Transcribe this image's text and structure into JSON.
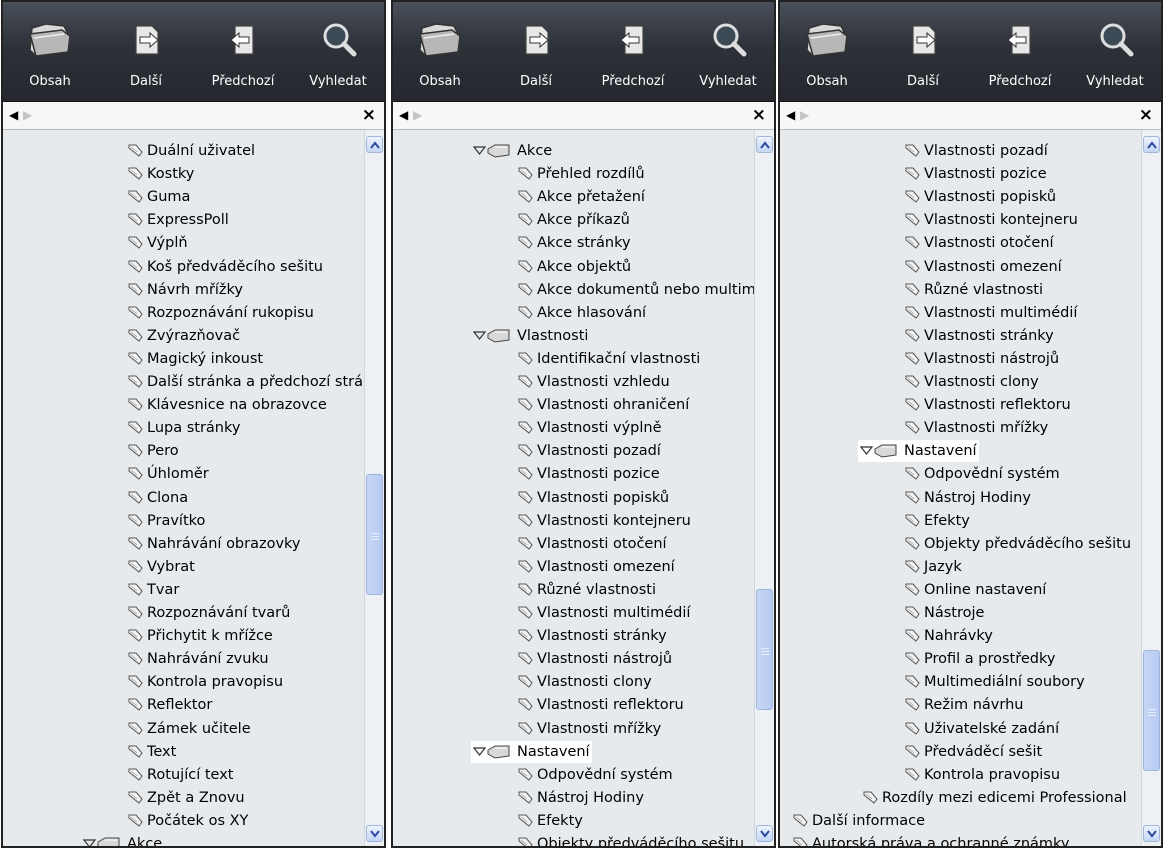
{
  "colors": {
    "toolbar_dark": "#2d3138",
    "tree_bg": "#e7eaed",
    "scroll_thumb": "#c6d6f6",
    "highlight": "#ffffff"
  },
  "icons": {
    "toc": "folder-icon",
    "next": "next-page-icon",
    "prev": "previous-page-icon",
    "search": "magnifier-icon",
    "leaf": "topic-page-icon",
    "group": "book-icon",
    "expanded": "triangle-down-icon",
    "close": "close-icon"
  },
  "panels": [
    {
      "toolbar": {
        "contents": "Obsah",
        "next": "Další",
        "previous": "Předchozí",
        "search": "Vyhledat"
      },
      "tabs": {
        "back": "◀",
        "forward": "▶",
        "close": "×"
      },
      "items": [
        {
          "type": "leaf",
          "indent": 2,
          "label": "Duální uživatel"
        },
        {
          "type": "leaf",
          "indent": 2,
          "label": "Kostky"
        },
        {
          "type": "leaf",
          "indent": 2,
          "label": "Guma"
        },
        {
          "type": "leaf",
          "indent": 2,
          "label": "ExpressPoll"
        },
        {
          "type": "leaf",
          "indent": 2,
          "label": "Výplň"
        },
        {
          "type": "leaf",
          "indent": 2,
          "label": "Koš předváděcího sešitu"
        },
        {
          "type": "leaf",
          "indent": 2,
          "label": "Návrh mřížky"
        },
        {
          "type": "leaf",
          "indent": 2,
          "label": "Rozpoznávání rukopisu"
        },
        {
          "type": "leaf",
          "indent": 2,
          "label": "Zvýrazňovač"
        },
        {
          "type": "leaf",
          "indent": 2,
          "label": "Magický inkoust"
        },
        {
          "type": "leaf",
          "indent": 2,
          "label": "Další stránka a předchozí strá"
        },
        {
          "type": "leaf",
          "indent": 2,
          "label": "Klávesnice na obrazovce"
        },
        {
          "type": "leaf",
          "indent": 2,
          "label": "Lupa stránky"
        },
        {
          "type": "leaf",
          "indent": 2,
          "label": "Pero"
        },
        {
          "type": "leaf",
          "indent": 2,
          "label": "Úhloměr"
        },
        {
          "type": "leaf",
          "indent": 2,
          "label": "Clona"
        },
        {
          "type": "leaf",
          "indent": 2,
          "label": "Pravítko"
        },
        {
          "type": "leaf",
          "indent": 2,
          "label": "Nahrávání obrazovky"
        },
        {
          "type": "leaf",
          "indent": 2,
          "label": "Vybrat"
        },
        {
          "type": "leaf",
          "indent": 2,
          "label": "Tvar"
        },
        {
          "type": "leaf",
          "indent": 2,
          "label": "Rozpoznávání tvarů"
        },
        {
          "type": "leaf",
          "indent": 2,
          "label": "Přichytit k mřížce"
        },
        {
          "type": "leaf",
          "indent": 2,
          "label": "Nahrávání zvuku"
        },
        {
          "type": "leaf",
          "indent": 2,
          "label": "Kontrola pravopisu"
        },
        {
          "type": "leaf",
          "indent": 2,
          "label": "Reflektor"
        },
        {
          "type": "leaf",
          "indent": 2,
          "label": "Zámek učitele"
        },
        {
          "type": "leaf",
          "indent": 2,
          "label": "Text"
        },
        {
          "type": "leaf",
          "indent": 2,
          "label": "Rotující text"
        },
        {
          "type": "leaf",
          "indent": 2,
          "label": "Zpět a Znovu"
        },
        {
          "type": "leaf",
          "indent": 2,
          "label": "Počátek os XY"
        },
        {
          "type": "group",
          "indent": 1,
          "label": "Akce"
        }
      ],
      "scroll": {
        "position": 0.58,
        "visible_fraction": 0.18
      }
    },
    {
      "toolbar": {
        "contents": "Obsah",
        "next": "Další",
        "previous": "Předchozí",
        "search": "Vyhledat"
      },
      "tabs": {
        "back": "◀",
        "forward": "▶",
        "close": "×"
      },
      "items": [
        {
          "type": "group",
          "indent": 1,
          "label": "Akce"
        },
        {
          "type": "leaf",
          "indent": 2,
          "label": "Přehled rozdílů"
        },
        {
          "type": "leaf",
          "indent": 2,
          "label": "Akce přetažení"
        },
        {
          "type": "leaf",
          "indent": 2,
          "label": "Akce příkazů"
        },
        {
          "type": "leaf",
          "indent": 2,
          "label": "Akce stránky"
        },
        {
          "type": "leaf",
          "indent": 2,
          "label": "Akce objektů"
        },
        {
          "type": "leaf",
          "indent": 2,
          "label": "Akce dokumentů nebo multimé"
        },
        {
          "type": "leaf",
          "indent": 2,
          "label": "Akce hlasování"
        },
        {
          "type": "group",
          "indent": 1,
          "label": "Vlastnosti"
        },
        {
          "type": "leaf",
          "indent": 2,
          "label": "Identifikační vlastnosti"
        },
        {
          "type": "leaf",
          "indent": 2,
          "label": "Vlastnosti vzhledu"
        },
        {
          "type": "leaf",
          "indent": 2,
          "label": "Vlastnosti ohraničení"
        },
        {
          "type": "leaf",
          "indent": 2,
          "label": "Vlastnosti výplně"
        },
        {
          "type": "leaf",
          "indent": 2,
          "label": "Vlastnosti pozadí"
        },
        {
          "type": "leaf",
          "indent": 2,
          "label": "Vlastnosti pozice"
        },
        {
          "type": "leaf",
          "indent": 2,
          "label": "Vlastnosti popisků"
        },
        {
          "type": "leaf",
          "indent": 2,
          "label": "Vlastnosti kontejneru"
        },
        {
          "type": "leaf",
          "indent": 2,
          "label": "Vlastnosti otočení"
        },
        {
          "type": "leaf",
          "indent": 2,
          "label": "Vlastnosti omezení"
        },
        {
          "type": "leaf",
          "indent": 2,
          "label": "Různé vlastnosti"
        },
        {
          "type": "leaf",
          "indent": 2,
          "label": "Vlastnosti multimédií"
        },
        {
          "type": "leaf",
          "indent": 2,
          "label": "Vlastnosti stránky"
        },
        {
          "type": "leaf",
          "indent": 2,
          "label": "Vlastnosti nástrojů"
        },
        {
          "type": "leaf",
          "indent": 2,
          "label": "Vlastnosti clony"
        },
        {
          "type": "leaf",
          "indent": 2,
          "label": "Vlastnosti reflektoru"
        },
        {
          "type": "leaf",
          "indent": 2,
          "label": "Vlastnosti mřížky"
        },
        {
          "type": "group",
          "indent": 1,
          "label": "Nastavení",
          "highlighted": true
        },
        {
          "type": "leaf",
          "indent": 2,
          "label": "Odpovědní systém"
        },
        {
          "type": "leaf",
          "indent": 2,
          "label": "Nástroj Hodiny"
        },
        {
          "type": "leaf",
          "indent": 2,
          "label": "Efekty"
        },
        {
          "type": "leaf",
          "indent": 2,
          "label": "Objekty předváděcího sešitu"
        }
      ],
      "scroll": {
        "position": 0.79,
        "visible_fraction": 0.18
      }
    },
    {
      "toolbar": {
        "contents": "Obsah",
        "next": "Další",
        "previous": "Předchozí",
        "search": "Vyhledat"
      },
      "tabs": {
        "back": "◀",
        "forward": "▶",
        "close": "×"
      },
      "items": [
        {
          "type": "leaf",
          "indent": 2,
          "label": "Vlastnosti pozadí"
        },
        {
          "type": "leaf",
          "indent": 2,
          "label": "Vlastnosti pozice"
        },
        {
          "type": "leaf",
          "indent": 2,
          "label": "Vlastnosti popisků"
        },
        {
          "type": "leaf",
          "indent": 2,
          "label": "Vlastnosti kontejneru"
        },
        {
          "type": "leaf",
          "indent": 2,
          "label": "Vlastnosti otočení"
        },
        {
          "type": "leaf",
          "indent": 2,
          "label": "Vlastnosti omezení"
        },
        {
          "type": "leaf",
          "indent": 2,
          "label": "Různé vlastnosti"
        },
        {
          "type": "leaf",
          "indent": 2,
          "label": "Vlastnosti multimédií"
        },
        {
          "type": "leaf",
          "indent": 2,
          "label": "Vlastnosti stránky"
        },
        {
          "type": "leaf",
          "indent": 2,
          "label": "Vlastnosti nástrojů"
        },
        {
          "type": "leaf",
          "indent": 2,
          "label": "Vlastnosti clony"
        },
        {
          "type": "leaf",
          "indent": 2,
          "label": "Vlastnosti reflektoru"
        },
        {
          "type": "leaf",
          "indent": 2,
          "label": "Vlastnosti mřížky"
        },
        {
          "type": "group",
          "indent": 1,
          "label": "Nastavení",
          "highlighted": true
        },
        {
          "type": "leaf",
          "indent": 2,
          "label": "Odpovědní systém"
        },
        {
          "type": "leaf",
          "indent": 2,
          "label": "Nástroj Hodiny"
        },
        {
          "type": "leaf",
          "indent": 2,
          "label": "Efekty"
        },
        {
          "type": "leaf",
          "indent": 2,
          "label": "Objekty předváděcího sešitu"
        },
        {
          "type": "leaf",
          "indent": 2,
          "label": "Jazyk"
        },
        {
          "type": "leaf",
          "indent": 2,
          "label": "Online nastavení"
        },
        {
          "type": "leaf",
          "indent": 2,
          "label": "Nástroje"
        },
        {
          "type": "leaf",
          "indent": 2,
          "label": "Nahrávky"
        },
        {
          "type": "leaf",
          "indent": 2,
          "label": "Profil a prostředky"
        },
        {
          "type": "leaf",
          "indent": 2,
          "label": "Multimediální soubory"
        },
        {
          "type": "leaf",
          "indent": 2,
          "label": "Režim návrhu"
        },
        {
          "type": "leaf",
          "indent": 2,
          "label": "Uživatelské zadání"
        },
        {
          "type": "leaf",
          "indent": 2,
          "label": "Předváděcí sešit"
        },
        {
          "type": "leaf",
          "indent": 2,
          "label": "Kontrola pravopisu"
        },
        {
          "type": "leaf",
          "indent": 1,
          "label": "Rozdíly mezi edicemi Professional"
        },
        {
          "type": "leaf",
          "indent": 0,
          "label": "Další informace"
        },
        {
          "type": "leaf",
          "indent": 0,
          "label": "Autorská práva a ochranné známky"
        }
      ],
      "scroll": {
        "position": 0.9,
        "visible_fraction": 0.18
      }
    }
  ]
}
